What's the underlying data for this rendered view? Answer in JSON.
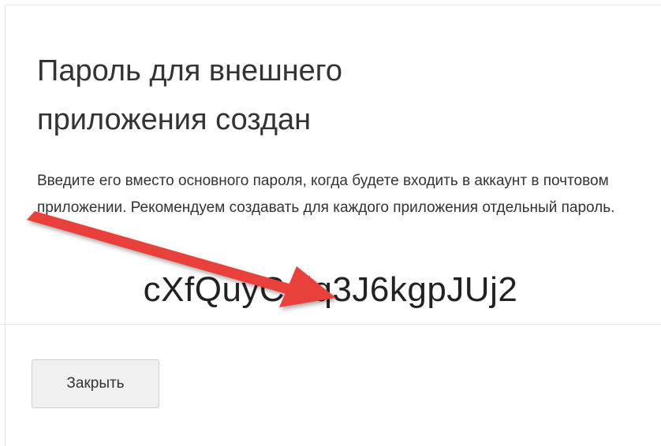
{
  "dialog": {
    "title": "Пароль для внешнего приложения создан",
    "description": "Введите его вместо основного пароля, когда будете входить в аккаунт в почтовом приложении. Рекомендуем создавать для каждого приложения отдельный пароль.",
    "password": "cXfQuyCdlq3J6kgpJUj2",
    "close_label": "Закрыть"
  },
  "annotation": {
    "arrow_icon": "red-arrow-icon",
    "arrow_color": "#e8413a"
  }
}
